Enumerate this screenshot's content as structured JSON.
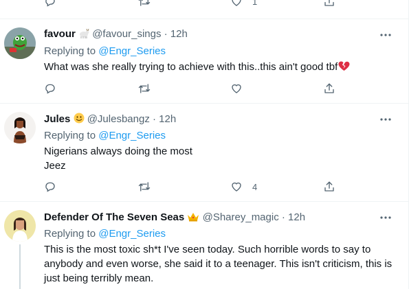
{
  "top_actions": {
    "like_count": "1"
  },
  "tweets": [
    {
      "name": "favour",
      "handle": "@favour_sings",
      "dot": "·",
      "time": "12h",
      "replying_label": "Replying to",
      "replying_to": "@Engr_Series",
      "text_lines": [
        "What was she really trying to achieve with this..this ain't good tbf"
      ],
      "emoji": "broken-heart-icon",
      "reply_count": "",
      "retweet_count": "",
      "like_count": ""
    },
    {
      "name": "Jules",
      "handle": "@Julesbangz",
      "dot": "·",
      "time": "12h",
      "replying_label": "Replying to",
      "replying_to": "@Engr_Series",
      "text_lines": [
        "Nigerians always doing the most",
        "Jeez"
      ],
      "reply_count": "",
      "retweet_count": "",
      "like_count": "4"
    },
    {
      "name": "Defender Of The Seven Seas",
      "handle": "@Sharey_magic",
      "dot": "·",
      "time": "12h",
      "replying_label": "Replying to",
      "replying_to": "@Engr_Series",
      "text_lines": [
        "This is the most toxic sh*t I've seen today. Such horrible words to say to",
        "anybody and even worse, she said it to a teenager. This isn't criticism, this is",
        "just being terribly mean."
      ]
    }
  ],
  "colors": {
    "accent": "#1d9bf0",
    "secondary_text": "#536471",
    "primary_text": "#0f1419",
    "divider": "#eff3f4"
  }
}
